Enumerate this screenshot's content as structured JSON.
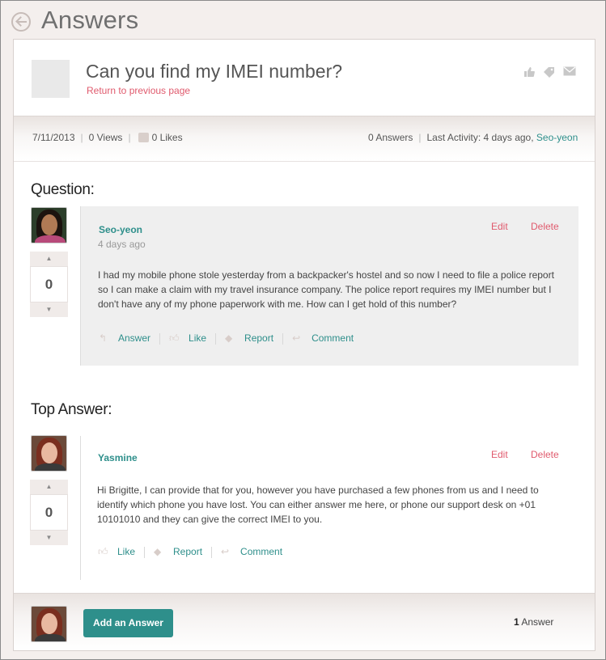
{
  "page": {
    "title": "Answers"
  },
  "question": {
    "title": "Can you find my IMEI number?",
    "return_link": "Return to previous page",
    "header_icons": [
      "like-icon",
      "tag-icon",
      "mail-icon"
    ],
    "meta": {
      "date": "7/11/2013",
      "views": "0 Views",
      "likes": "0 Likes",
      "answers": "0 Answers",
      "last_activity_label": "Last Activity: 4 days ago,",
      "last_activity_user": "Seo-yeon"
    },
    "section_label": "Question:",
    "author": "Seo-yeon",
    "time": "4 days ago",
    "edit": "Edit",
    "delete": "Delete",
    "votes": "0",
    "body": "I had my mobile phone stole yesterday from a backpacker's hostel and so now I need to file a police report so I can make a claim with my travel insurance company. The police report requires my IMEI number but I don't have any of my phone paperwork with me. How can I get hold of this number?",
    "actions": {
      "answer": "Answer",
      "like": "Like",
      "report": "Report",
      "comment": "Comment"
    }
  },
  "top_answer": {
    "section_label": "Top Answer:",
    "author": "Yasmine",
    "edit": "Edit",
    "delete": "Delete",
    "votes": "0",
    "body": "Hi Brigitte, I can provide that for you, however you have purchased a few phones from us and I need to identify which phone you have lost. You can either answer me here, or phone our support desk on +01 10101010 and they can give the correct IMEI to you.",
    "actions": {
      "like": "Like",
      "report": "Report",
      "comment": "Comment"
    }
  },
  "footer": {
    "add_button": "Add an Answer",
    "answer_count": "1",
    "answer_label": "Answer"
  },
  "colors": {
    "accent": "#2e8f8b",
    "link_red": "#e05a6d",
    "background": "#f4efed"
  }
}
